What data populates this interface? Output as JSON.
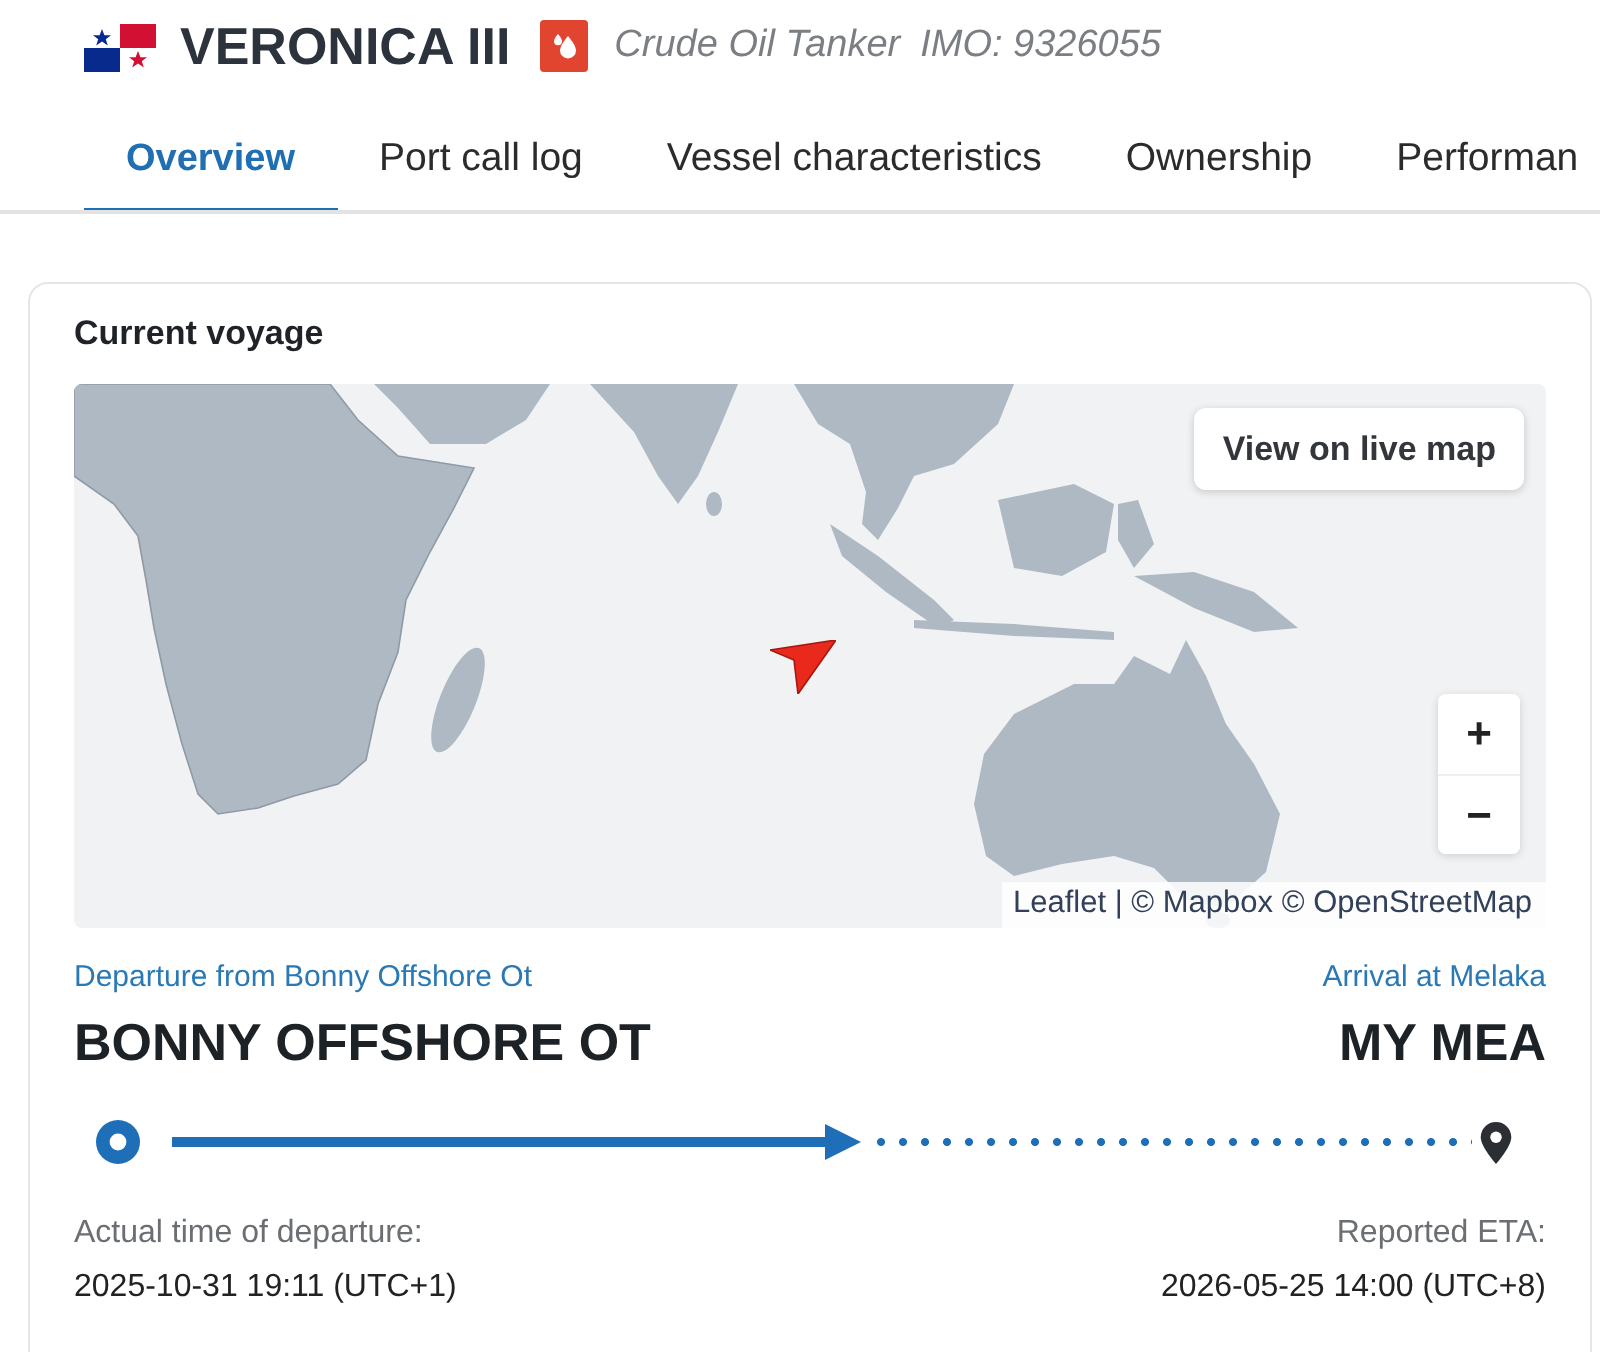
{
  "header": {
    "title": "VERONICA III",
    "vessel_type": "Crude Oil Tanker",
    "imo": "IMO: 9326055"
  },
  "tabs": [
    {
      "label": "Overview",
      "selected": true
    },
    {
      "label": "Port call log",
      "selected": false
    },
    {
      "label": "Vessel characteristics",
      "selected": false
    },
    {
      "label": "Ownership",
      "selected": false
    },
    {
      "label": "Performan",
      "selected": false
    }
  ],
  "voyage": {
    "title": "Current voyage",
    "map": {
      "live_map_button": "View on live map",
      "zoom_in": "+",
      "zoom_out": "−",
      "attribution": "Leaflet | © Mapbox © OpenStreetMap"
    },
    "departure": {
      "caption": "Departure from Bonny Offshore Ot",
      "port": "BONNY OFFSHORE OT",
      "time_label": "Actual time of departure:",
      "time": "2025-10-31 19:11 (UTC+1)"
    },
    "arrival": {
      "caption": "Arrival at Melaka",
      "port": "MY MEA",
      "time_label": "Reported ETA:",
      "time": "2026-05-25 14:00 (UTC+8)"
    },
    "progress": {
      "level": 0.53
    }
  }
}
